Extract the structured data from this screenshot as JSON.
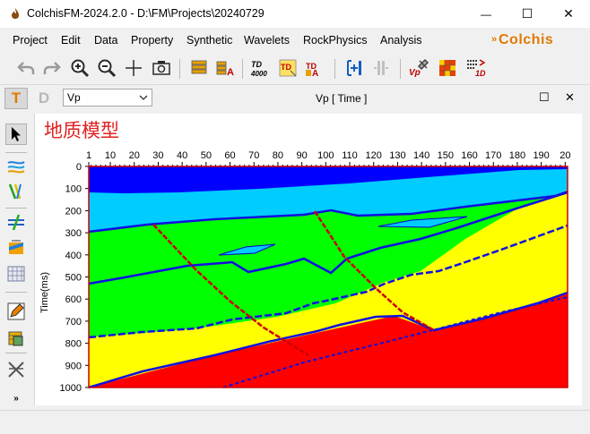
{
  "window": {
    "title": "ColchisFM-2024.2.0 - D:\\FM\\Projects\\20240729",
    "minimize": "—",
    "maximize": "☐",
    "close": "✕"
  },
  "menu": [
    "Project",
    "Edit",
    "Data",
    "Property",
    "Synthetic",
    "Wavelets",
    "RockPhysics",
    "Analysis"
  ],
  "logo": "Colchis",
  "toolbar_icons": [
    "undo-icon",
    "redo-icon",
    "zoom-in-icon",
    "zoom-out-icon",
    "crosshair-icon",
    "camera-icon",
    "layers-stack-icon",
    "layers-a-icon",
    "depth-to-time-icon",
    "time-depth-1d-icon",
    "time-depth-na-icon",
    "add-panel-icon",
    "split-panel-icon",
    "vp-settings-icon",
    "grid-color-icon",
    "wavelet-1d-icon"
  ],
  "toolbar_labels": {
    "td_avg": "TD",
    "td_4000": "4000"
  },
  "secondary": {
    "t_label": "T",
    "d_label": "D",
    "property_select": "Vp",
    "panel_title": "Vp [ Time ]",
    "panel_restore": "☐",
    "panel_close": "✕"
  },
  "left_tools": [
    "pointer-icon",
    "horizons-icon",
    "faults-icon",
    "fault-edit-icon",
    "model-build-icon",
    "grid-icon",
    "pencil-icon",
    "paint-bucket-icon",
    "cross-section-icon",
    "expand-more-icon"
  ],
  "colors": {
    "layer_top": "#0000ff",
    "layer_water": "#00ccff",
    "layer_green": "#00ff00",
    "layer_yellow": "#ffff00",
    "layer_red": "#ff0000",
    "horizon_line": "#0000ff",
    "fault_line": "#cc0000",
    "title_red": "#e02020",
    "logo_orange": "#e07a00"
  },
  "chart_data": {
    "type": "heatmap",
    "title": "地质模型",
    "xlabel": "",
    "ylabel": "Time(ms)",
    "x_ticks": [
      "1",
      "10",
      "20",
      "30",
      "40",
      "50",
      "60",
      "70",
      "80",
      "90",
      "100",
      "110",
      "120",
      "130",
      "140",
      "150",
      "160",
      "170",
      "180",
      "190",
      "20"
    ],
    "y_ticks": [
      "0",
      "100",
      "200",
      "300",
      "400",
      "500",
      "600",
      "700",
      "800",
      "900",
      "1000"
    ],
    "xlim": [
      1,
      201
    ],
    "ylim": [
      1000,
      0
    ]
  }
}
